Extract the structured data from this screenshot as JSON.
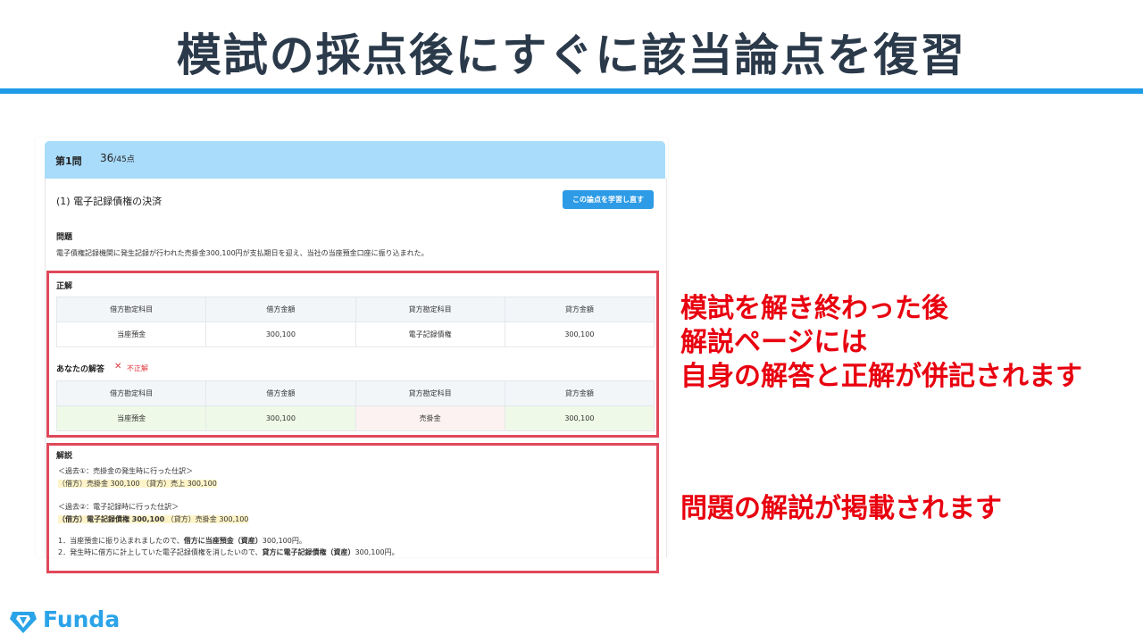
{
  "slide": {
    "title": "模試の採点後にすぐに該当論点を復習",
    "note1": [
      "模試を解き終わった後",
      "解説ページには",
      "自身の解答と正解が併記されます"
    ],
    "note2": "問題の解説が掲載されます",
    "logo_text": "Funda",
    "colors": {
      "accent": "#1f9be8",
      "note_red": "#e8000f",
      "box_red": "#e0485a",
      "header_blue": "#a9dcfb"
    }
  },
  "screenshot": {
    "question_label": "第1問",
    "score": "36",
    "score_total": "/45点",
    "topic": "(1) 電子記録債権の決済",
    "study_button": "この論点を学習し直す",
    "problem_label": "問題",
    "problem_text": "電子債権記録機関に発生記録が行われた売掛金300,100円が支払期日を迎え、当社の当座預金口座に振り込まれた。",
    "correct_label": "正解",
    "your_answer_label": "あなたの解答",
    "wrong_text": "不正解",
    "headers": [
      "借方勘定科目",
      "借方金額",
      "貸方勘定科目",
      "貸方金額"
    ],
    "correct_row": [
      "当座預金",
      "300,100",
      "電子記録債権",
      "300,100"
    ],
    "answer_row": [
      "当座預金",
      "300,100",
      "売掛金",
      "300,100"
    ],
    "explanation_label": "解説",
    "explanation": {
      "past1_title": "＜過去①：売掛金の発生時に行った仕訳＞",
      "past1_entry": "（借方）売掛金 300,100 （貸方）売上 300,100",
      "past2_title": "＜過去②：電子記録時に行った仕訳＞",
      "past2_entry_bold": "（借方）電子記録債権 300,100",
      "past2_entry_rest": " （貸方）売掛金 300,100",
      "step1_a": "1．当座預金に振り込まれましたので、",
      "step1_b": "借方に当座預金（資産）",
      "step1_c": "300,100円。",
      "step2_a": "2．発生時に借方に計上していた電子記録債権を消したいので、",
      "step2_b": "貸方に電子記録債権（資産）",
      "step2_c": "300,100円。"
    }
  }
}
